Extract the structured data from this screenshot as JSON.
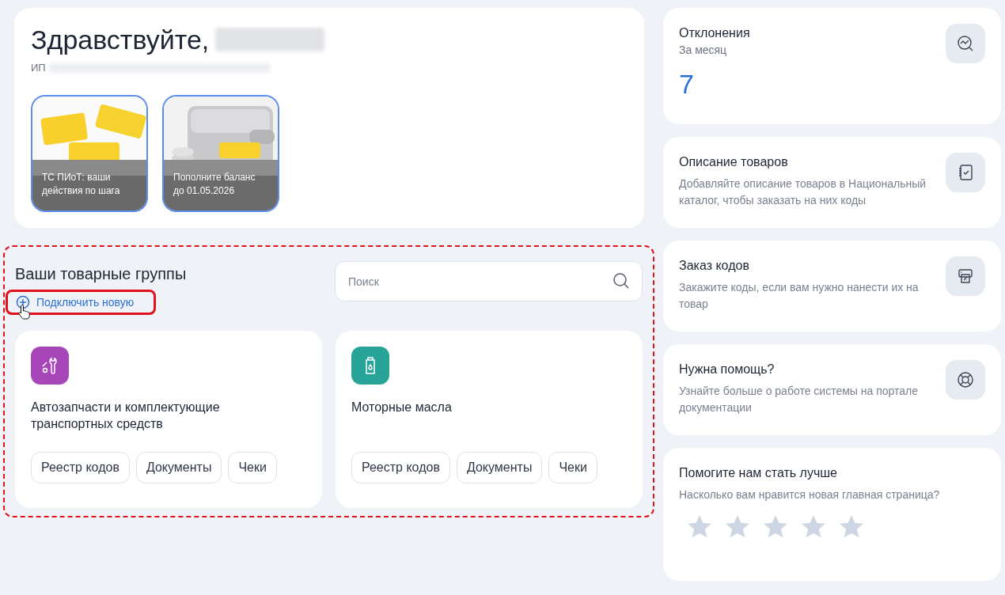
{
  "greeting": {
    "title": "Здравствуйте,",
    "org_prefix": "ИП"
  },
  "stories": [
    {
      "kind": "stickers",
      "title": "ТС ПИоТ: ваши действия по шага"
    },
    {
      "kind": "wallet",
      "title": "Пополните баланс до 01.05.2026"
    }
  ],
  "groups_section": {
    "title": "Ваши товарные группы",
    "connect_link": "Подключить новую",
    "search": {
      "placeholder": "Поиск"
    },
    "groups": [
      {
        "name": "Автозапчасти и комплектующие транспортных средств",
        "color": "#a646b8",
        "actions": [
          "Реестр кодов",
          "Документы",
          "Чеки"
        ]
      },
      {
        "name": "Моторные масла",
        "color": "#27a397",
        "actions": [
          "Реестр кодов",
          "Документы",
          "Чеки"
        ]
      }
    ]
  },
  "side_cards": [
    {
      "kind": "stat",
      "title": "Отклонения",
      "subtitle": "За месяц",
      "value": "7"
    },
    {
      "kind": "info",
      "title": "Описание товаров",
      "text": "Добавляйте описание товаров в Национальный каталог, чтобы заказать на них коды"
    },
    {
      "kind": "info",
      "title": "Заказ кодов",
      "text": "Закажите коды, если вам нужно нанести их на товар"
    },
    {
      "kind": "info",
      "title": "Нужна помощь?",
      "text": "Узнайте больше о работе системы на портале документации"
    },
    {
      "kind": "rating",
      "title": "Помогите нам стать лучше",
      "text": "Насколько вам нравится новая главная страница?",
      "stars": 0
    }
  ]
}
